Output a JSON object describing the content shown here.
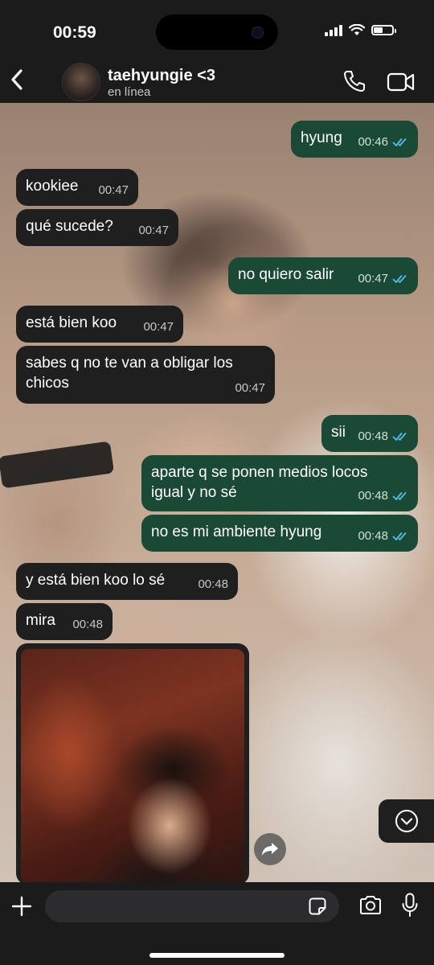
{
  "status_bar": {
    "time": "00:59",
    "battery_level": 0.5
  },
  "header": {
    "contact_name": "taehyungie <3",
    "contact_status": "en línea"
  },
  "messages": [
    {
      "dir": "out",
      "text": "hyung",
      "time": "00:46",
      "read": true
    },
    {
      "dir": "in",
      "text": "kookiee",
      "time": "00:47"
    },
    {
      "dir": "in",
      "text": "qué sucede?",
      "time": "00:47"
    },
    {
      "dir": "out",
      "text": "no quiero salir",
      "time": "00:47",
      "read": true
    },
    {
      "dir": "in",
      "text": "está bien koo",
      "time": "00:47"
    },
    {
      "dir": "in",
      "text_line1": "sabes q no te van a obligar los",
      "text_line2": "chicos",
      "time": "00:47"
    },
    {
      "dir": "out",
      "text": "sii",
      "time": "00:48",
      "read": true
    },
    {
      "dir": "out",
      "text_line1": "aparte q se ponen medios locos",
      "text_line2": "igual y no sé",
      "time": "00:48",
      "read": true
    },
    {
      "dir": "out",
      "text": "no es mi ambiente hyung",
      "time": "00:48",
      "read": true
    },
    {
      "dir": "in",
      "text": "y está bien koo lo sé",
      "time": "00:48"
    },
    {
      "dir": "in",
      "text": "mira",
      "time": "00:48"
    }
  ],
  "icons": {
    "back": "chevron-left-icon",
    "call": "phone-icon",
    "video": "video-camera-icon",
    "forward": "forward-icon",
    "scroll": "chevron-down-circle-icon",
    "plus": "plus-icon",
    "sticker": "sticker-icon",
    "camera": "camera-icon",
    "mic": "microphone-icon"
  },
  "colors": {
    "outgoing_bubble": "#1a4a35",
    "incoming_bubble": "#1f1f1f",
    "read_check": "#53bdeb",
    "bar": "#1b1b1b"
  }
}
